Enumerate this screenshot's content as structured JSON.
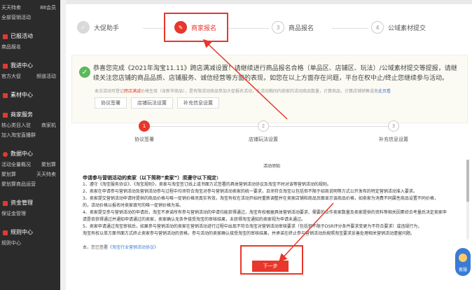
{
  "sidebar": {
    "top_row": {
      "left": "天天特卖",
      "right": "88会员"
    },
    "top_sub": "全部营销活动",
    "groups": [
      {
        "title": "已报活动",
        "rows": [
          {
            "left": "商品报名",
            "right": ""
          }
        ]
      },
      {
        "title": "我进中心",
        "rows": [
          {
            "left": "官方大促",
            "right": "频道活动"
          }
        ]
      },
      {
        "title": "素材中心",
        "rows": []
      },
      {
        "title": "商家服务",
        "rows": [
          {
            "left": "核心类目入驻",
            "right": "商家机"
          },
          {
            "left": "加入淘宝直播群",
            "right": ""
          }
        ]
      },
      {
        "title": "数据中心",
        "rows": [
          {
            "left": "活动全量概况",
            "right": "聚划算"
          },
          {
            "left": "聚划算",
            "right": "天天特卖"
          },
          {
            "left": "聚划算商品运营",
            "right": ""
          }
        ]
      },
      {
        "title": "资金管理",
        "rows": [
          {
            "left": "保证金管理",
            "right": ""
          }
        ]
      },
      {
        "title": "规则中心",
        "rows": [
          {
            "left": "规则中心",
            "right": ""
          }
        ]
      }
    ]
  },
  "steps_top": [
    {
      "num": "✓",
      "label": "大促助手",
      "state": "done"
    },
    {
      "num": "✎",
      "label": "商家报名",
      "state": "active"
    },
    {
      "num": "3",
      "label": "商品报名",
      "state": "todo"
    },
    {
      "num": "4",
      "label": "公域素材提交",
      "state": "todo"
    }
  ],
  "notice": {
    "text": "恭喜您完成《2021年淘宝11.11》跨店满减设置！请继续进行商品报名合格（单品区、店铺区、玩法）/公域素材提交等提报，请继续关注您店铺的商品品质、店铺服务、诚信经营等方面的表现，如您在以上方面存在问题，平台在权中止/终止您继续参与活动。",
    "sub_prefix": "本次活动可登记",
    "sub_hl": "跨店满减",
    "sub_mid": "价格生效（含新市商品），是有限活动商品参加大促报名活动，在活动期间内商家的活动商品数量，计算商品，计算店铺销售或者",
    "sub_link": "此页看",
    "buttons": [
      "协议签署",
      "店铺玩法设置",
      "补充信息设置"
    ]
  },
  "sub_steps": [
    {
      "num": "1",
      "label": "协议签署",
      "state": "active"
    },
    {
      "num": "2",
      "label": "店铺玩法设置",
      "state": "todo"
    },
    {
      "num": "3",
      "label": "补充信息设置",
      "state": "todo"
    }
  ],
  "agreement": {
    "title": "活动须知",
    "head": "申请参与营销活动的卖家（以下简称“卖家”）须遵守以下规定:",
    "lines": [
      "1、遵守《淘宝服务协议》、《淘宝规则》，卖家与淘宝签订线上或书面方式签署的具体营销活动协议及淘宝不时对该等营销活动的规则。",
      "2、卖家在申请参与营销活动及营销活动参与过程中均须符合淘宝对参与营销活动卖家的统一要求，且须符合淘宝以包括但不限于招商说明等方式公开发布的特定营销活动准入要求。",
      "3、卖家提交营销活动申请时提供的商品价格与唯一促销价格须真实有效，淘宝有权在活动开始时重新调整并在卖家店铺和商品页面显示该商品价格，如卖家为消费不同属性商品设置不同价格，",
      "   的，活动价格以报名时卖家填写的唯一促销价格为准。",
      "4、卖家提交参与营销活动的申请后，淘宝不承诺所有参与营销活动的申请均能获得通过，淘宝有权根据具体营销活动要求、需要的合作卖家数量及卖家提供的资料等相关因素综合考量后决定卖家申",
      "   请是否获得通过并通知申请通过的卖家，卖家确认无条件接受淘宝的审核结果，未获得淘宝通知的卖家视为申请未通过。",
      "5、卖家申请通过淘宝审核后，如果参与营销活动的卖家在营销活动进行过程中出现不符合淘宝对营销活动审核要求（包括但不限于DSR评分条件要求变更为不符合要求）或违规行为，",
      "   淘宝有权以单方面书面方式终止卖家参与营销活动的资格，参与活动的卖家确认接受淘宝的审核结果，并承诺在终止参与营销活动后按照淘宝要求妥善处理相关营销活动遗留问题。"
    ],
    "footer_prefix": "本，您已签署",
    "footer_link": "《淘宝行业营销活动协议》"
  },
  "next_button": "下一步",
  "kefu_label": "客服",
  "colors": {
    "accent": "#e8372b",
    "sidebar_bg": "#2b2b2b",
    "link": "#3a7bd5"
  }
}
